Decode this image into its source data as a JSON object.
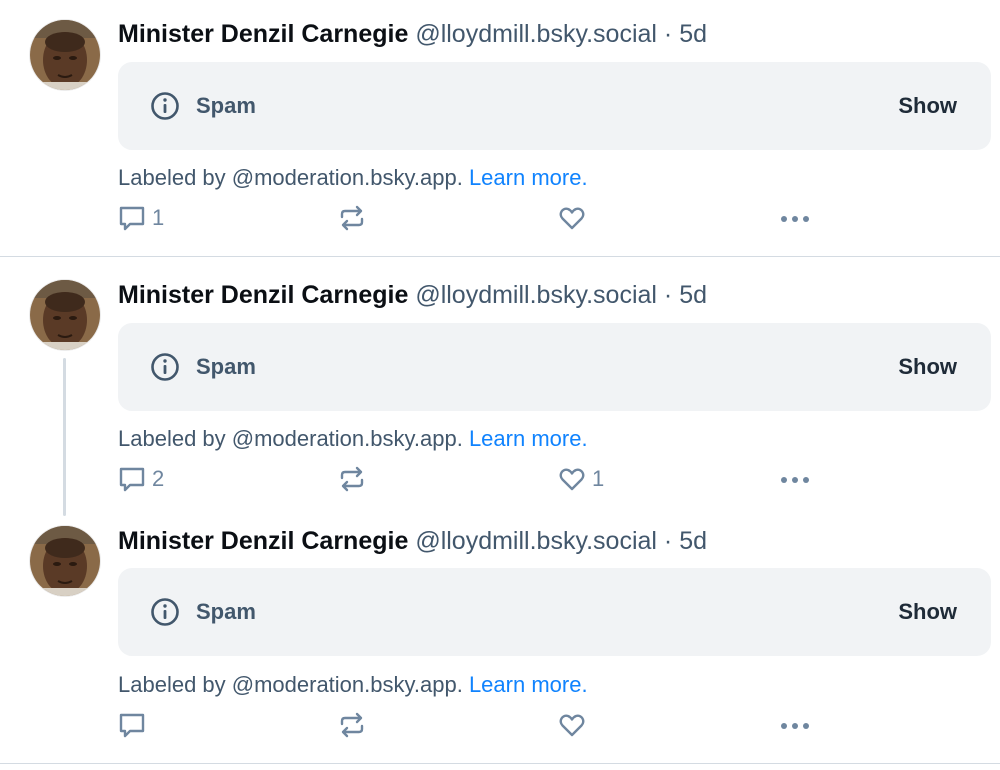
{
  "posts": [
    {
      "author_name": "Minister Denzil Carnegie",
      "author_handle": "@lloydmill.bsky.social",
      "separator": "·",
      "time": "5d",
      "content_label": "Spam",
      "show_label": "Show",
      "labeled_by": "Labeled by @moderation.bsky.app.",
      "learn_more": "Learn more.",
      "reply_count": "1",
      "repost_count": "",
      "like_count": ""
    },
    {
      "author_name": "Minister Denzil Carnegie",
      "author_handle": "@lloydmill.bsky.social",
      "separator": "·",
      "time": "5d",
      "content_label": "Spam",
      "show_label": "Show",
      "labeled_by": "Labeled by @moderation.bsky.app.",
      "learn_more": "Learn more.",
      "reply_count": "2",
      "repost_count": "",
      "like_count": "1"
    },
    {
      "author_name": "Minister Denzil Carnegie",
      "author_handle": "@lloydmill.bsky.social",
      "separator": "·",
      "time": "5d",
      "content_label": "Spam",
      "show_label": "Show",
      "labeled_by": "Labeled by @moderation.bsky.app.",
      "learn_more": "Learn more.",
      "reply_count": "",
      "repost_count": "",
      "like_count": ""
    }
  ],
  "icons": {
    "info": "info-circle-icon",
    "reply": "speech-bubble-icon",
    "repost": "repost-arrows-icon",
    "like": "heart-icon",
    "more": "ellipsis-icon"
  },
  "colors": {
    "link": "#1083fe",
    "muted_text": "#42576c",
    "icon": "#6f869f",
    "label_box": "#f1f3f5",
    "divider": "#d4dbe2"
  }
}
